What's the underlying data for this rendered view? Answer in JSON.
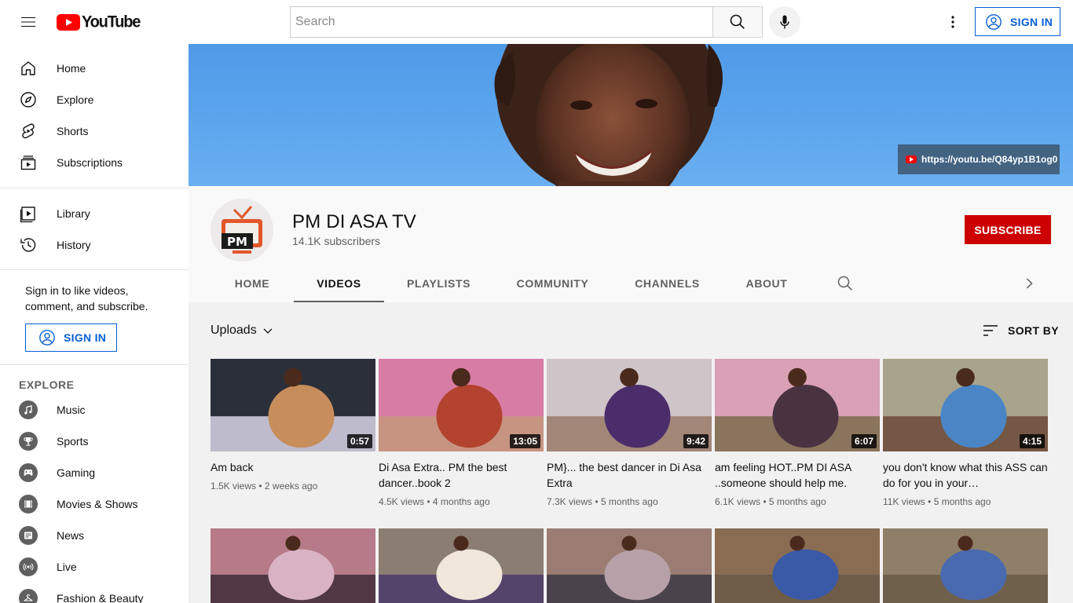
{
  "header": {
    "logo_text": "YouTube",
    "search_placeholder": "Search",
    "sign_in_label": "SIGN IN"
  },
  "sidebar": {
    "main": [
      {
        "label": "Home",
        "icon": "home-icon"
      },
      {
        "label": "Explore",
        "icon": "compass-icon"
      },
      {
        "label": "Shorts",
        "icon": "shorts-icon"
      },
      {
        "label": "Subscriptions",
        "icon": "subscriptions-icon"
      }
    ],
    "library": [
      {
        "label": "Library",
        "icon": "library-icon"
      },
      {
        "label": "History",
        "icon": "history-icon"
      }
    ],
    "signin_text": "Sign in to like videos, comment, and subscribe.",
    "signin_label": "SIGN IN",
    "explore_title": "EXPLORE",
    "explore": [
      {
        "label": "Music",
        "icon": "music-icon"
      },
      {
        "label": "Sports",
        "icon": "trophy-icon"
      },
      {
        "label": "Gaming",
        "icon": "gamepad-icon"
      },
      {
        "label": "Movies & Shows",
        "icon": "film-icon"
      },
      {
        "label": "News",
        "icon": "news-icon"
      },
      {
        "label": "Live",
        "icon": "live-icon"
      },
      {
        "label": "Fashion & Beauty",
        "icon": "hanger-icon"
      }
    ]
  },
  "banner": {
    "link_text": "https://youtu.be/Q84yp1B1og0"
  },
  "channel": {
    "name": "PM DI ASA TV",
    "subscribers": "14.1K subscribers",
    "subscribe_label": "SUBSCRIBE",
    "avatar_text": "PM",
    "tabs": [
      {
        "label": "HOME",
        "active": false
      },
      {
        "label": "VIDEOS",
        "active": true
      },
      {
        "label": "PLAYLISTS",
        "active": false
      },
      {
        "label": "COMMUNITY",
        "active": false
      },
      {
        "label": "CHANNELS",
        "active": false
      },
      {
        "label": "ABOUT",
        "active": false
      }
    ]
  },
  "content": {
    "uploads_label": "Uploads",
    "sort_label": "SORT BY",
    "videos": [
      {
        "title": "Am back",
        "views": "1.5K views",
        "age": "2 weeks ago",
        "duration": "0:57",
        "colors": [
          "#2b2f3a",
          "#c78d5a",
          "#d8d4e6"
        ]
      },
      {
        "title": "Di Asa Extra.. PM the best dancer..book 2",
        "views": "4.5K views",
        "age": "4 months ago",
        "duration": "13:05",
        "colors": [
          "#d77ca4",
          "#b3432e",
          "#c6997c"
        ]
      },
      {
        "title": "PM}... the best dancer in Di Asa Extra",
        "views": "7.3K views",
        "age": "5 months ago",
        "duration": "9:42",
        "colors": [
          "#cfc4c8",
          "#4b2d6b",
          "#9a7b6a"
        ]
      },
      {
        "title": "am feeling HOT..PM DI ASA ..someone should help me.",
        "views": "6.1K views",
        "age": "5 months ago",
        "duration": "6:07",
        "colors": [
          "#d9a0b6",
          "#4a3340",
          "#7b6c4e"
        ]
      },
      {
        "title": "you don't know what this ASS can do for you in your…",
        "views": "11K views",
        "age": "5 months ago",
        "duration": "4:15",
        "colors": [
          "#a8a38c",
          "#4a86c6",
          "#6c4a38"
        ]
      }
    ],
    "second_row_colors": [
      [
        "#b67a88",
        "#d9b3c3",
        "#3f2d38"
      ],
      [
        "#8c7d73",
        "#f0e6da",
        "#4a3a6a"
      ],
      [
        "#9a7c72",
        "#b8a0a8",
        "#3d3a44"
      ],
      [
        "#8a6c52",
        "#3a5aa8",
        "#6a5a48"
      ],
      [
        "#8f7f68",
        "#4a6ab0",
        "#6a5a48"
      ]
    ]
  }
}
